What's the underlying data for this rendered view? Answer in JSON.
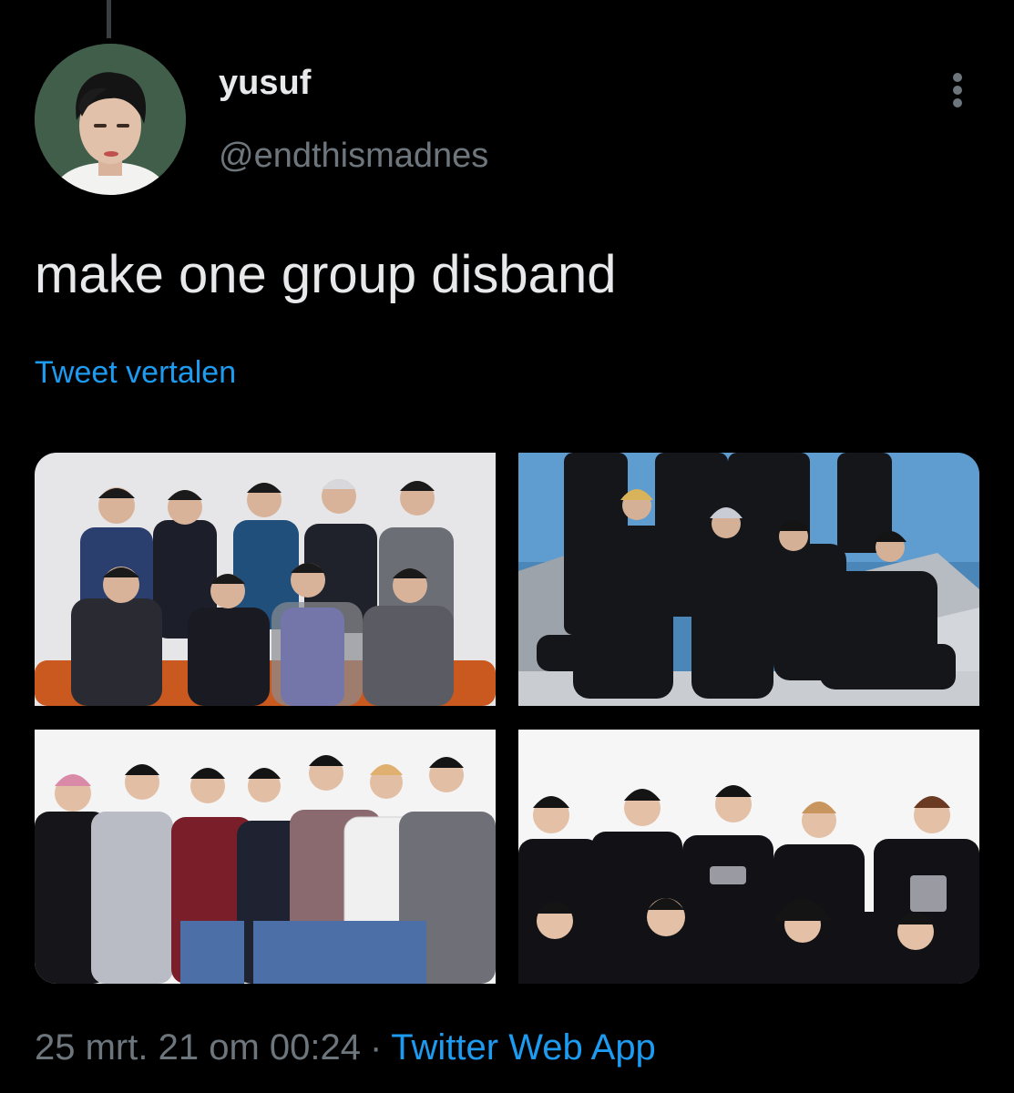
{
  "tweet": {
    "display_name": "yusuf",
    "handle": "@endthismadnes",
    "text": "make one group disband",
    "translate_label": "Tweet vertalen",
    "timestamp": "25 mrt. 21 om 00:24",
    "separator": "·",
    "source": "Twitter Web App"
  },
  "icons": {
    "more": "more-vertical-icon"
  },
  "colors": {
    "background": "#000000",
    "text_primary": "#e7e9ea",
    "text_secondary": "#6e767d",
    "link": "#1d9bf0"
  }
}
